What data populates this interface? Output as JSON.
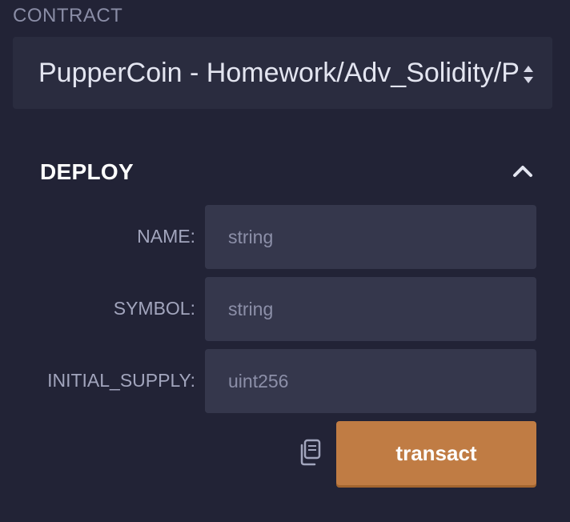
{
  "contract": {
    "label": "CONTRACT",
    "selected": "PupperCoin - Homework/Adv_Solidity/PupperCoin.sol"
  },
  "deploy": {
    "title": "DEPLOY",
    "collapse_icon": "chevron-up-icon",
    "params": [
      {
        "label": "NAME:",
        "placeholder": "string",
        "value": ""
      },
      {
        "label": "SYMBOL:",
        "placeholder": "string",
        "value": ""
      },
      {
        "label": "INITIAL_SUPPLY:",
        "placeholder": "uint256",
        "value": ""
      }
    ],
    "copy_icon": "copy-icon",
    "transact_label": "transact"
  },
  "colors": {
    "background": "#222336",
    "panel": "#2a2c3f",
    "input": "#35374c",
    "accent": "#c07c44"
  }
}
